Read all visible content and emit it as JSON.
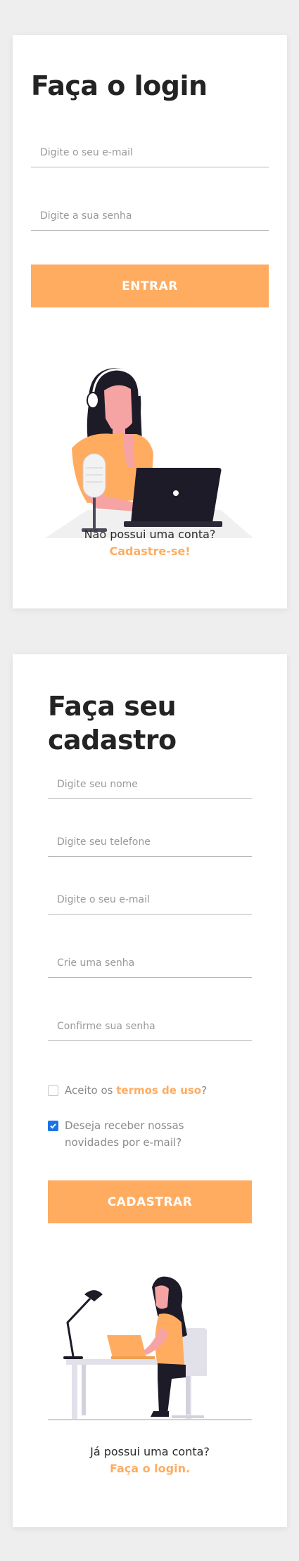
{
  "login": {
    "title": "Faça o login",
    "email_placeholder": "Digite o seu e-mail",
    "password_placeholder": "Digite a sua senha",
    "submit_label": "ENTRAR",
    "no_account_text": "Não possui uma conta?",
    "signup_link": "Cadastre-se!",
    "illustration": "woman-podcasting-with-laptop-illustration"
  },
  "signup": {
    "title_line1": "Faça seu",
    "title_line2": "cadastro",
    "name_placeholder": "Digite seu nome",
    "phone_placeholder": "Digite seu telefone",
    "email_placeholder": "Digite o seu e-mail",
    "password_placeholder": "Crie uma senha",
    "confirm_placeholder": "Confirme sua senha",
    "terms_prefix": "Aceito os ",
    "terms_link": "termos de uso",
    "terms_suffix": "?",
    "terms_checked": false,
    "newsletter_line1": "Deseja receber nossas",
    "newsletter_line2": "novidades por e-mail?",
    "newsletter_checked": true,
    "submit_label": "CADASTRAR",
    "has_account_text": "Já possui uma conta?",
    "login_link": "Faça o login.",
    "illustration": "woman-working-at-desk-illustration"
  },
  "colors": {
    "accent": "#ffac61",
    "checkbox_checked": "#1a73e8",
    "background": "#eeeeee",
    "card": "#ffffff"
  }
}
